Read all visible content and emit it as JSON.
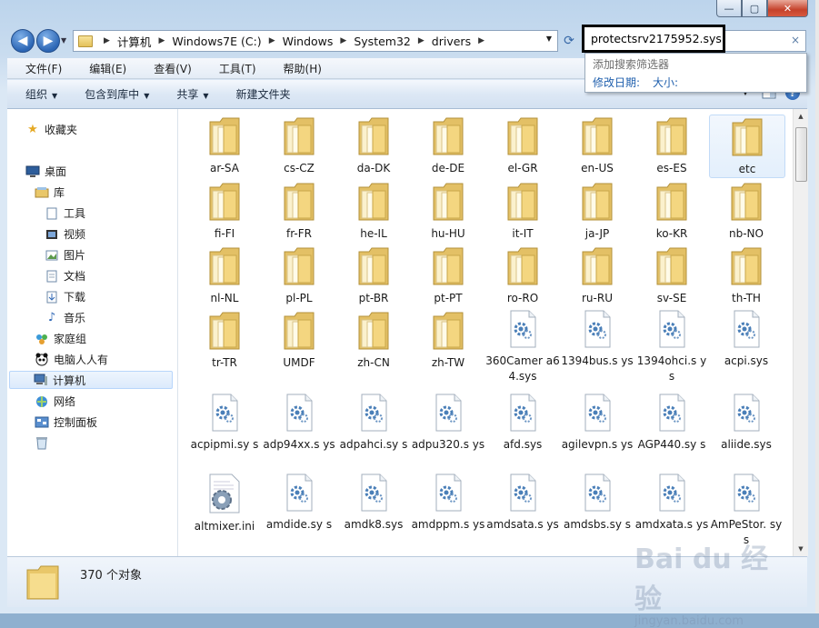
{
  "window": {
    "title": "drivers",
    "caption_buttons": [
      "—",
      "▢",
      "✕"
    ]
  },
  "nav": {
    "back_icon": "back-arrow-icon",
    "forward_icon": "forward-arrow-icon",
    "breadcrumbs": [
      "计算机",
      "Windows7E (C:)",
      "Windows",
      "System32",
      "drivers"
    ]
  },
  "search": {
    "value": "protectsrv2175952.sys",
    "clear_glyph": "×",
    "filter_title": "添加搜索筛选器",
    "filters": [
      "修改日期:",
      "大小:"
    ]
  },
  "menu": [
    "文件(F)",
    "编辑(E)",
    "查看(V)",
    "工具(T)",
    "帮助(H)"
  ],
  "commands": [
    {
      "label": "组织",
      "dropdown": true
    },
    {
      "label": "包含到库中",
      "dropdown": true
    },
    {
      "label": "共享",
      "dropdown": true
    },
    {
      "label": "新建文件夹",
      "dropdown": false
    }
  ],
  "sidebar": {
    "favorites": "收藏夹",
    "desktop": "桌面",
    "library": "库",
    "library_items": [
      "工具",
      "视频",
      "图片",
      "文档",
      "下载",
      "音乐"
    ],
    "homegroup": "家庭组",
    "pc_people": "电脑人人有",
    "computer": "计算机",
    "network": "网络",
    "control_panel": "控制面板"
  },
  "files": [
    {
      "name": "ar-SA",
      "type": "folder"
    },
    {
      "name": "cs-CZ",
      "type": "folder"
    },
    {
      "name": "da-DK",
      "type": "folder"
    },
    {
      "name": "de-DE",
      "type": "folder"
    },
    {
      "name": "el-GR",
      "type": "folder"
    },
    {
      "name": "en-US",
      "type": "folder"
    },
    {
      "name": "es-ES",
      "type": "folder"
    },
    {
      "name": "etc",
      "type": "folder",
      "selected": true
    },
    {
      "name": "fi-FI",
      "type": "folder"
    },
    {
      "name": "fr-FR",
      "type": "folder"
    },
    {
      "name": "he-IL",
      "type": "folder"
    },
    {
      "name": "hu-HU",
      "type": "folder"
    },
    {
      "name": "it-IT",
      "type": "folder"
    },
    {
      "name": "ja-JP",
      "type": "folder"
    },
    {
      "name": "ko-KR",
      "type": "folder"
    },
    {
      "name": "nb-NO",
      "type": "folder"
    },
    {
      "name": "nl-NL",
      "type": "folder"
    },
    {
      "name": "pl-PL",
      "type": "folder"
    },
    {
      "name": "pt-BR",
      "type": "folder"
    },
    {
      "name": "pt-PT",
      "type": "folder"
    },
    {
      "name": "ro-RO",
      "type": "folder"
    },
    {
      "name": "ru-RU",
      "type": "folder"
    },
    {
      "name": "sv-SE",
      "type": "folder"
    },
    {
      "name": "th-TH",
      "type": "folder"
    },
    {
      "name": "tr-TR",
      "type": "folder"
    },
    {
      "name": "UMDF",
      "type": "folder"
    },
    {
      "name": "zh-CN",
      "type": "folder"
    },
    {
      "name": "zh-TW",
      "type": "folder"
    },
    {
      "name": "360Camer a64.sys",
      "type": "sys"
    },
    {
      "name": "1394bus.s ys",
      "type": "sys"
    },
    {
      "name": "1394ohci.s ys",
      "type": "sys"
    },
    {
      "name": "acpi.sys",
      "type": "sys"
    },
    {
      "name": "acpipmi.sy s",
      "type": "sys"
    },
    {
      "name": "adp94xx.s ys",
      "type": "sys"
    },
    {
      "name": "adpahci.sy s",
      "type": "sys"
    },
    {
      "name": "adpu320.s ys",
      "type": "sys"
    },
    {
      "name": "afd.sys",
      "type": "sys"
    },
    {
      "name": "agilevpn.s ys",
      "type": "sys"
    },
    {
      "name": "AGP440.sy s",
      "type": "sys"
    },
    {
      "name": "aliide.sys",
      "type": "sys"
    },
    {
      "name": "altmixer.ini",
      "type": "ini"
    },
    {
      "name": "amdide.sy s",
      "type": "sys"
    },
    {
      "name": "amdk8.sys",
      "type": "sys"
    },
    {
      "name": "amdppm.s ys",
      "type": "sys"
    },
    {
      "name": "amdsata.s ys",
      "type": "sys"
    },
    {
      "name": "amdsbs.sy s",
      "type": "sys"
    },
    {
      "name": "amdxata.s ys",
      "type": "sys"
    },
    {
      "name": "AmPeStor. sys",
      "type": "sys"
    }
  ],
  "details": {
    "count": "370 个对象"
  },
  "watermark": {
    "text": "Bai du 经验",
    "sub": "jingyan.baidu.com"
  },
  "colors": {
    "accent": "#2c66b5",
    "folder": "#f3d27a",
    "filter_link": "#1f5fad"
  }
}
